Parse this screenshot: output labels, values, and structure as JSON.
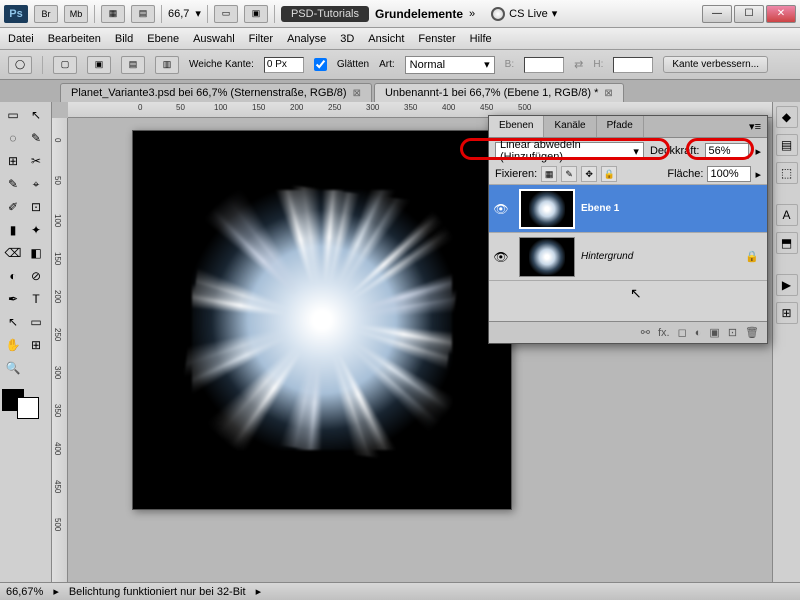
{
  "title": {
    "zoom": "66,7",
    "workspace_label": "PSD-Tutorials",
    "doc_label": "Grundelemente",
    "cslive": "CS Live"
  },
  "mini_buttons": [
    "Br",
    "Mb"
  ],
  "menu": [
    "Datei",
    "Bearbeiten",
    "Bild",
    "Ebene",
    "Auswahl",
    "Filter",
    "Analyse",
    "3D",
    "Ansicht",
    "Fenster",
    "Hilfe"
  ],
  "options": {
    "feather_label": "Weiche Kante:",
    "feather_value": "0 Px",
    "antialias_label": "Glätten",
    "style_label": "Art:",
    "style_value": "Normal",
    "width_label": "B:",
    "height_label": "H:",
    "refine": "Kante verbessern..."
  },
  "tabs": [
    {
      "label": "Planet_Variante3.psd bei 66,7% (Sternenstraße, RGB/8)",
      "active": false
    },
    {
      "label": "Unbenannt-1 bei 66,7% (Ebene 1, RGB/8) *",
      "active": true
    }
  ],
  "ruler_h": [
    "0",
    "50",
    "100",
    "150",
    "200",
    "250",
    "300",
    "350",
    "400",
    "450",
    "500"
  ],
  "ruler_v": [
    "0",
    "50",
    "100",
    "150",
    "200",
    "250",
    "300",
    "350",
    "400",
    "450",
    "500"
  ],
  "layers_panel": {
    "tabs": [
      "Ebenen",
      "Kanäle",
      "Pfade"
    ],
    "blend_mode": "Linear abwedeln (Hinzufügen)",
    "opacity_label": "Deckkraft:",
    "opacity_value": "56%",
    "lock_label": "Fixieren:",
    "fill_label": "Fläche:",
    "fill_value": "100%",
    "layers": [
      {
        "name": "Ebene 1",
        "active": true,
        "locked": false
      },
      {
        "name": "Hintergrund",
        "active": false,
        "locked": true
      }
    ]
  },
  "status": {
    "zoom": "66,67%",
    "msg": "Belichtung funktioniert nur bei 32-Bit"
  },
  "tools": [
    "▭",
    "↖",
    "◌",
    "✎",
    "⊞",
    "✂",
    "✎",
    "⌖",
    "✐",
    "⊡",
    "▮",
    "✦",
    "⌫",
    "◧",
    "◐",
    "⊘",
    "✒",
    "T",
    "↖",
    "▭",
    "✋",
    "⊞",
    "↔",
    "🔍"
  ],
  "rail_icons": [
    "◆",
    "▤",
    "⬚",
    "A",
    "⬒",
    "▶",
    "⊞"
  ]
}
